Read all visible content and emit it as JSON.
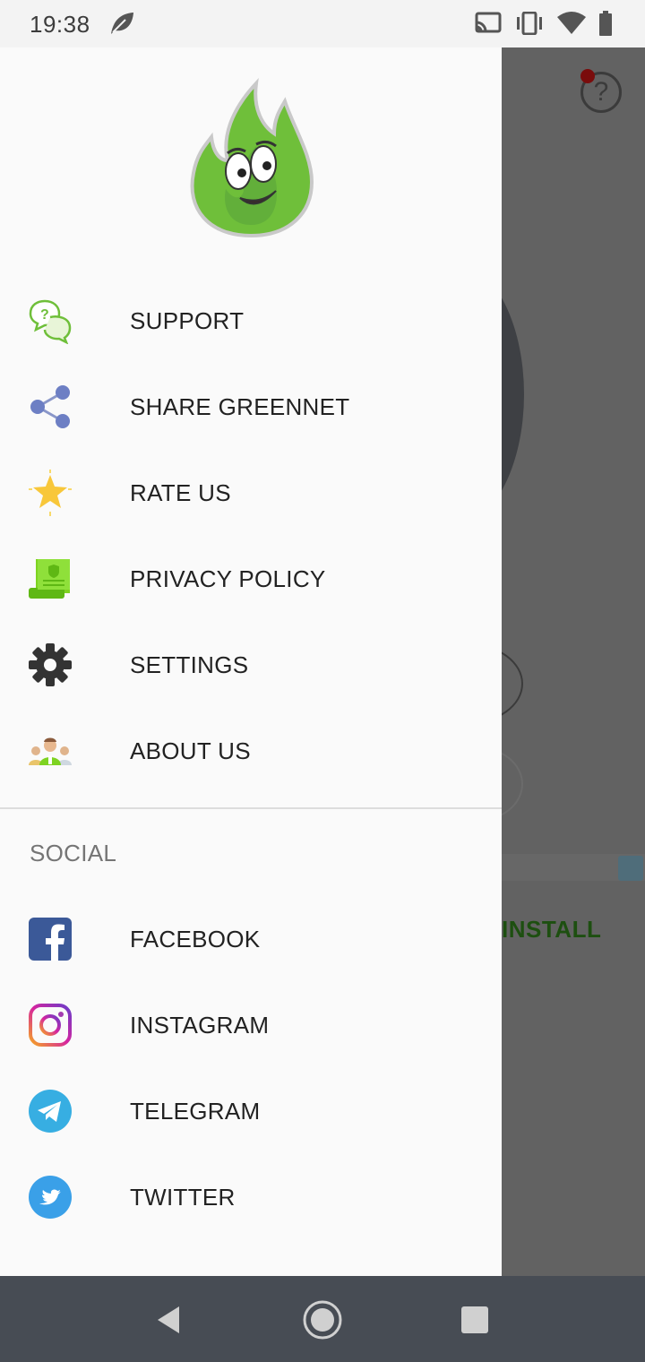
{
  "status_bar": {
    "time": "19:38",
    "icons": [
      "leaf-icon",
      "cast-icon",
      "vibrate-icon",
      "wifi-icon",
      "battery-icon"
    ]
  },
  "background_app": {
    "install_label": "INSTALL",
    "help_glyph": "?"
  },
  "drawer": {
    "logo": "greennet-flame-mascot",
    "items": [
      {
        "label": "SUPPORT",
        "icon": "support-chat-icon"
      },
      {
        "label": "SHARE GREENNET",
        "icon": "share-icon"
      },
      {
        "label": "RATE US",
        "icon": "star-icon"
      },
      {
        "label": "PRIVACY POLICY",
        "icon": "policy-scroll-icon"
      },
      {
        "label": "SETTINGS",
        "icon": "gear-icon"
      },
      {
        "label": "ABOUT US",
        "icon": "team-icon"
      }
    ],
    "social_header": "SOCIAL",
    "social_items": [
      {
        "label": "FACEBOOK",
        "icon": "facebook-icon"
      },
      {
        "label": "INSTAGRAM",
        "icon": "instagram-icon"
      },
      {
        "label": "TELEGRAM",
        "icon": "telegram-icon"
      },
      {
        "label": "TWITTER",
        "icon": "twitter-icon"
      }
    ]
  },
  "nav_bar": {
    "buttons": [
      "back-icon",
      "home-icon",
      "recents-icon"
    ]
  },
  "colors": {
    "accent_green": "#6fbf3a",
    "drawer_bg": "#fafafa",
    "scrim": "#626262",
    "navbar": "#474c54"
  }
}
